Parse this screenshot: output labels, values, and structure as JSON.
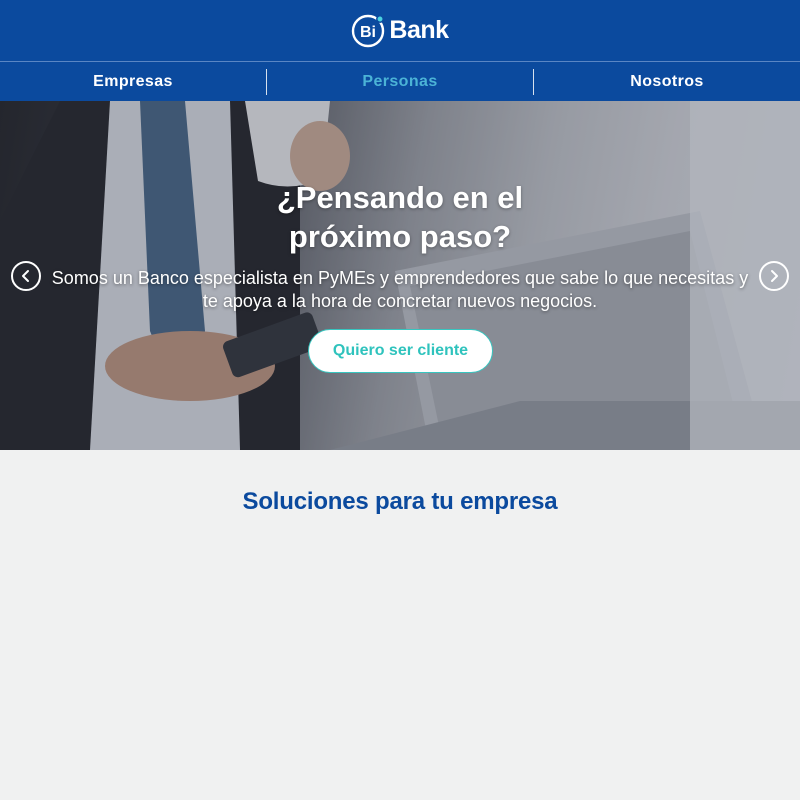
{
  "brand": {
    "logo_mark": "Bi",
    "logo_text": "Bank",
    "primary_color": "#0b4a9e",
    "accent_color": "#2fc3bd",
    "nav_active_color": "#4bb3d6"
  },
  "nav": {
    "items": [
      {
        "label": "Empresas",
        "active": false
      },
      {
        "label": "Personas",
        "active": true
      },
      {
        "label": "Nosotros",
        "active": false
      }
    ]
  },
  "hero": {
    "title": "¿Pensando en el próximo paso?",
    "subtitle": "Somos un Banco especialista en PyMEs y emprendedores que sabe lo que necesitas y te apoya a la hora de concretar nuevos negocios.",
    "cta_label": "Quiero ser cliente",
    "prev_icon": "chevron-left-icon",
    "next_icon": "chevron-right-icon"
  },
  "section": {
    "title": "Soluciones para tu empresa"
  }
}
